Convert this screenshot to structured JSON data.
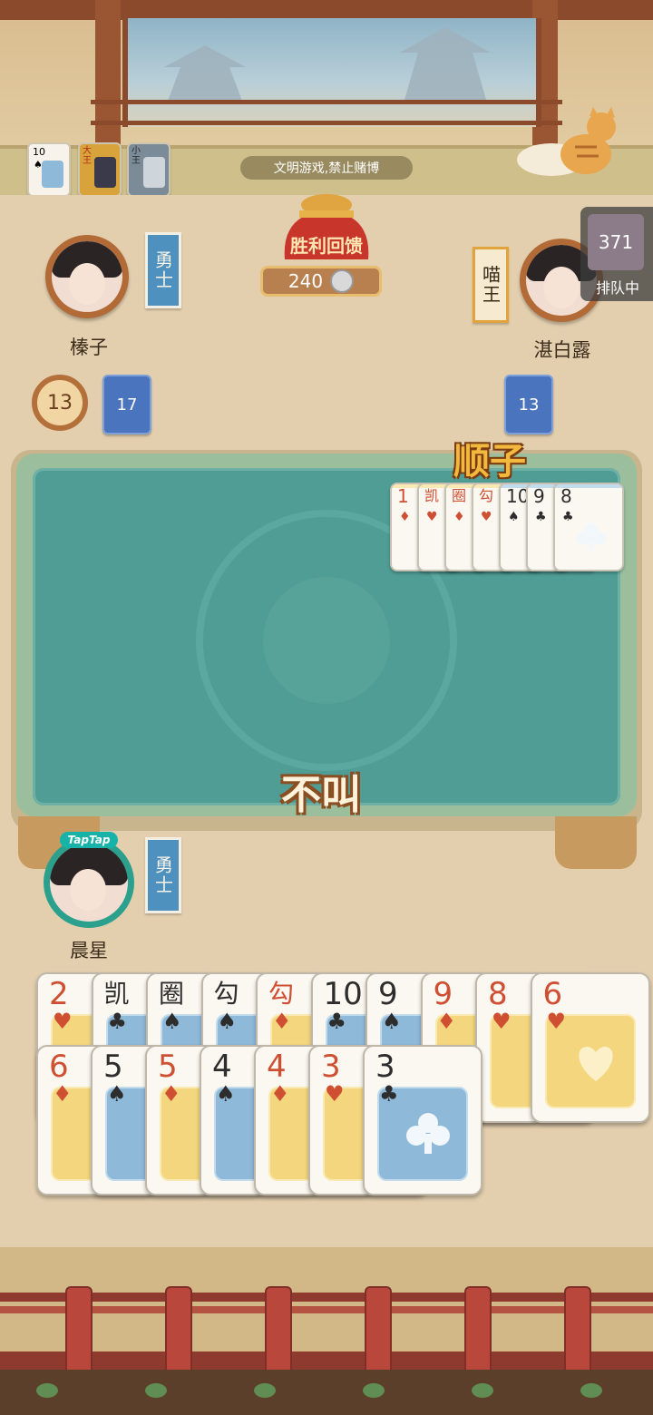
{
  "top": {
    "notice": "文明游戏,禁止赌博",
    "mini_cards": [
      {
        "label": "10",
        "suit": "♠"
      },
      {
        "label": "大王",
        "suit": ""
      },
      {
        "label": "小王",
        "suit": ""
      }
    ]
  },
  "reward": {
    "label": "胜利回馈",
    "amount": "240"
  },
  "queue": {
    "count": "371",
    "label": "排队中"
  },
  "players": {
    "left": {
      "name": "榛子",
      "title": "勇士",
      "cards_left": "17",
      "timer": "13"
    },
    "right": {
      "name": "湛白露",
      "title": "喵王",
      "cards_left": "13"
    },
    "me": {
      "name": "晨星",
      "title": "勇士",
      "badge": "TapTap"
    }
  },
  "table": {
    "right_play_label": "顺子",
    "my_action": "不叫",
    "right_played": [
      {
        "rank": "1",
        "suit": "♦",
        "color": "red"
      },
      {
        "rank": "凯",
        "suit": "♥",
        "color": "red"
      },
      {
        "rank": "圈",
        "suit": "♦",
        "color": "red"
      },
      {
        "rank": "勾",
        "suit": "♥",
        "color": "red"
      },
      {
        "rank": "10",
        "suit": "♠",
        "color": "black"
      },
      {
        "rank": "9",
        "suit": "♣",
        "color": "black"
      },
      {
        "rank": "8",
        "suit": "♣",
        "color": "black"
      }
    ]
  },
  "hand": {
    "row1": [
      {
        "rank": "2",
        "suit": "♥",
        "color": "red"
      },
      {
        "rank": "凯",
        "suit": "♣",
        "color": "black"
      },
      {
        "rank": "圈",
        "suit": "♠",
        "color": "black"
      },
      {
        "rank": "勾",
        "suit": "♠",
        "color": "black"
      },
      {
        "rank": "勾",
        "suit": "♦",
        "color": "red"
      },
      {
        "rank": "10",
        "suit": "♣",
        "color": "black"
      },
      {
        "rank": "9",
        "suit": "♠",
        "color": "black"
      },
      {
        "rank": "9",
        "suit": "♦",
        "color": "red"
      },
      {
        "rank": "8",
        "suit": "♥",
        "color": "red"
      },
      {
        "rank": "6",
        "suit": "♥",
        "color": "red"
      }
    ],
    "row2": [
      {
        "rank": "6",
        "suit": "♦",
        "color": "red"
      },
      {
        "rank": "5",
        "suit": "♠",
        "color": "black"
      },
      {
        "rank": "5",
        "suit": "♦",
        "color": "red"
      },
      {
        "rank": "4",
        "suit": "♠",
        "color": "black"
      },
      {
        "rank": "4",
        "suit": "♦",
        "color": "red"
      },
      {
        "rank": "3",
        "suit": "♥",
        "color": "red"
      },
      {
        "rank": "3",
        "suit": "♣",
        "color": "black"
      }
    ]
  }
}
